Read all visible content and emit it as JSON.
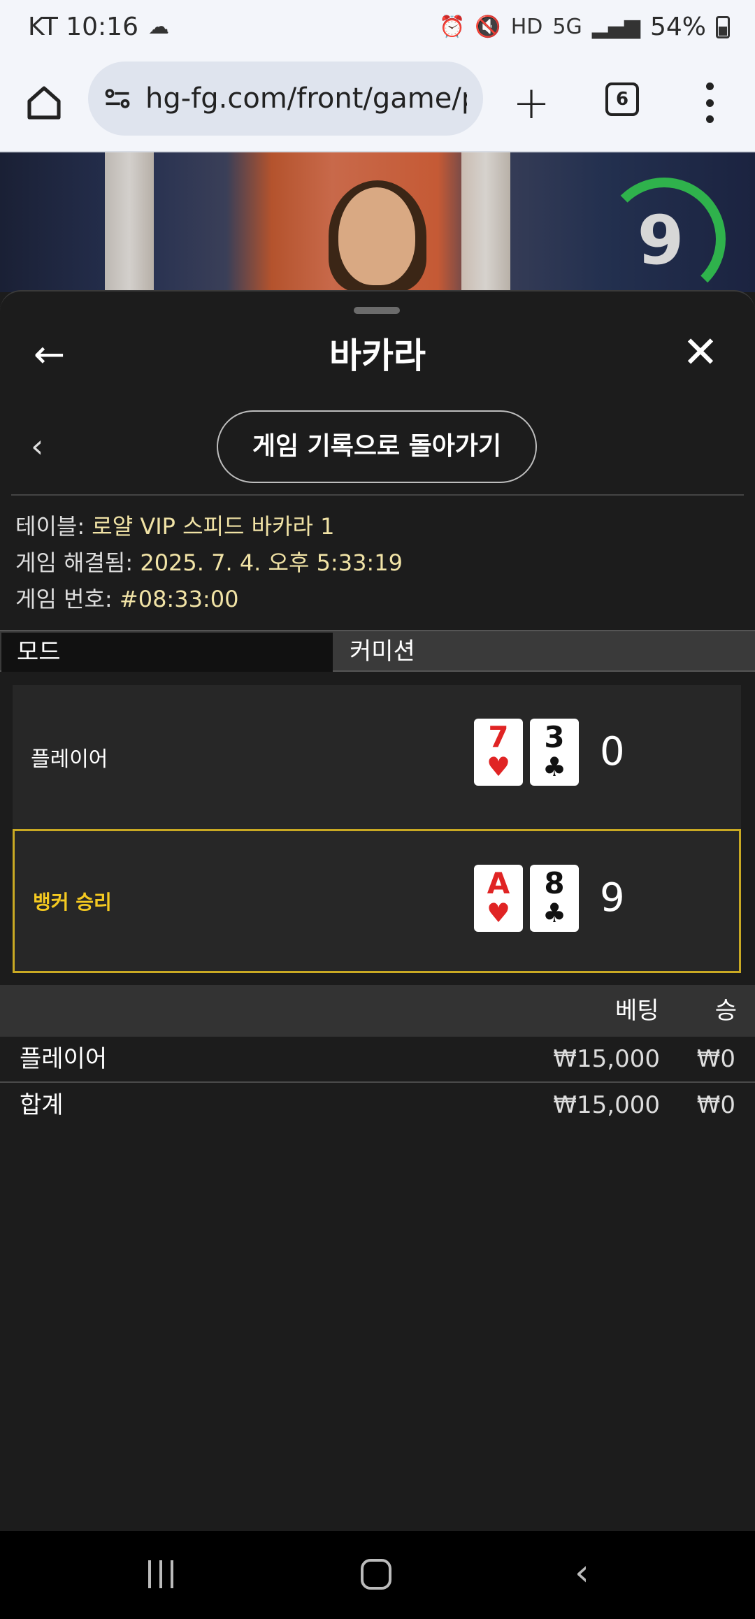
{
  "status_bar": {
    "carrier_time": "KT 10:16",
    "signal": "5G",
    "battery": "54%"
  },
  "browser": {
    "url": "hg-fg.com/front/game/p",
    "tab_count": "6"
  },
  "stream": {
    "countdown": "9",
    "countdown_color": "#2fb24c"
  },
  "sheet": {
    "title": "바카라",
    "back_to_history": "게임 기록으로 돌아가기",
    "info": {
      "table_label": "테이블: ",
      "table_value": "로얄 VIP 스피드 바카라 1",
      "resolved_label": "게임 해결됨: ",
      "resolved_value": "2025. 7. 4. 오후 5:33:19",
      "number_label": "게임 번호: ",
      "number_value": "#08:33:00"
    },
    "mode_label": "모드",
    "mode_value": "커미션",
    "hands": [
      {
        "label": "플레이어",
        "score": "0",
        "cards": [
          {
            "rank": "7",
            "suit": "♥"
          },
          {
            "rank": "3",
            "suit": "♣"
          }
        ]
      },
      {
        "label": "뱅커 승리",
        "score": "9",
        "cards": [
          {
            "rank": "A",
            "suit": "♥"
          },
          {
            "rank": "8",
            "suit": "♣"
          }
        ]
      }
    ],
    "bets": {
      "header_bet": "베팅",
      "header_win": "승",
      "rows": [
        {
          "name": "플레이어",
          "amount": "₩15,000",
          "win": "₩0"
        }
      ],
      "total": {
        "name": "합계",
        "amount": "₩15,000",
        "win": "₩0"
      }
    }
  },
  "colors": {
    "accent_gold": "#c9a923",
    "winner_text": "#f4c921",
    "info_value": "#f1e3a6"
  }
}
